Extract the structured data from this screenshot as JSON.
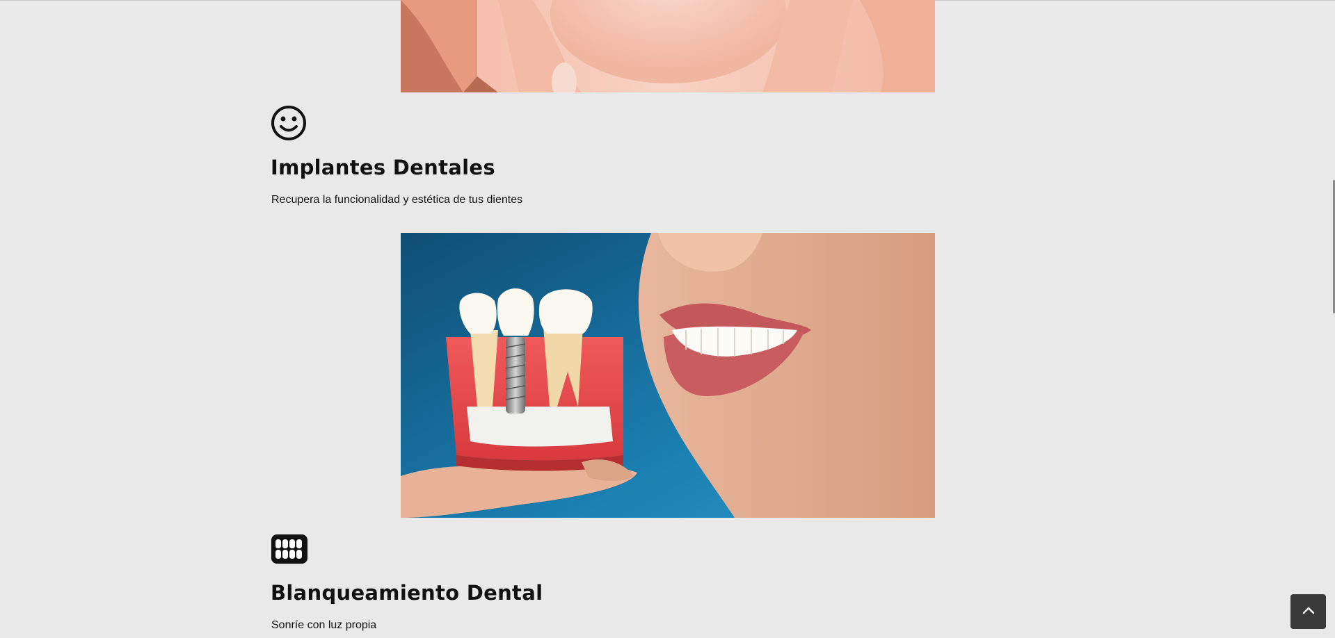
{
  "services": [
    {
      "icon": "smile-icon",
      "title": "Implantes Dentales",
      "description": "Recupera la funcionalidad y estética de tus dientes"
    },
    {
      "icon": "teeth-icon",
      "title": "Blanqueamiento Dental",
      "description": "Sonríe con luz propia"
    }
  ],
  "controls": {
    "back_to_top_icon": "chevron-up-icon"
  },
  "colors": {
    "background": "#e9e9e9",
    "text": "#111111",
    "back_to_top_bg": "#3a3a3a",
    "photo_blue": "#1f7fb0"
  }
}
